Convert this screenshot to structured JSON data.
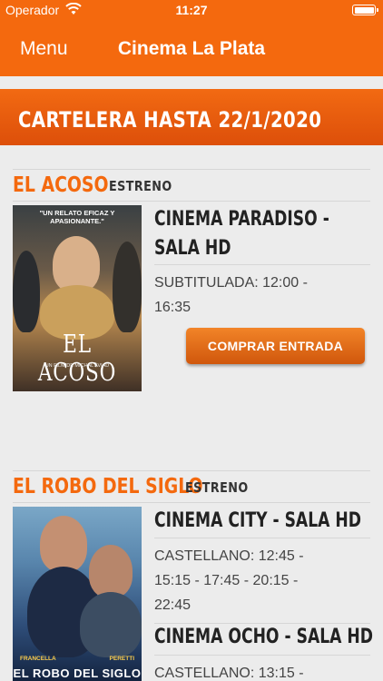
{
  "status_bar": {
    "carrier": "Operador",
    "time": "11:27"
  },
  "nav": {
    "menu_label": "Menu",
    "title": "Cinema La Plata"
  },
  "banner": {
    "text": "CARTELERA HASTA 22/1/2020"
  },
  "movies": [
    {
      "title": "EL ACOSO",
      "badge": "ESTRENO",
      "poster": {
        "tagline": "\"UN RELATO EFICAZ Y APASIONANTE.\"",
        "title": "EL ACOSO",
        "credit": "UN FILM DE MICHAL AVIAD"
      },
      "showings": [
        {
          "cinema_line1": "CINEMA PARADISO -",
          "cinema_line2": "SALA HD",
          "schedule_line1": "SUBTITULADA: 12:00 -",
          "schedule_line2": "16:35"
        }
      ],
      "buy_label": "COMPRAR ENTRADA"
    },
    {
      "title": "EL ROBO DEL SIGLO",
      "badge": "ESTRENO",
      "poster": {
        "actor1": "FRANCELLA",
        "actor2": "PERETTI",
        "title": "EL ROBO DEL SIGLO"
      },
      "showings": [
        {
          "cinema": "CINEMA CITY - SALA HD",
          "schedule_line1": "CASTELLANO: 12:45 -",
          "schedule_line2": "15:15 - 17:45 - 20:15 -",
          "schedule_line3": "22:45"
        },
        {
          "cinema": "CINEMA OCHO - SALA HD",
          "schedule_line1": "CASTELLANO: 13:15 -"
        }
      ]
    }
  ],
  "colors": {
    "brand_orange": "#f4690e",
    "background": "#ececec"
  }
}
